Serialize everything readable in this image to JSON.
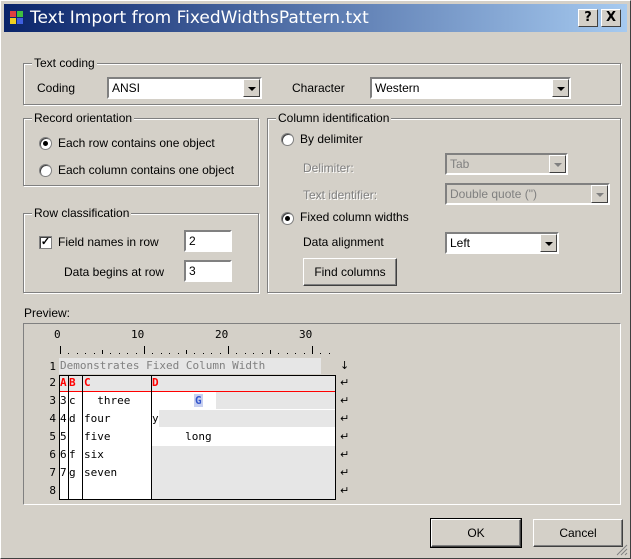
{
  "window": {
    "title": "Text Import from FixedWidthsPattern.txt",
    "help_label": "?",
    "close_label": "X",
    "icon": "table-import-icon"
  },
  "text_coding": {
    "legend": "Text coding",
    "coding_label": "Coding",
    "coding_value": "ANSI",
    "character_label": "Character",
    "character_value": "Western"
  },
  "record_orientation": {
    "legend": "Record orientation",
    "option_rows": "Each row contains one object",
    "option_columns": "Each column contains one object",
    "selected": "rows"
  },
  "row_classification": {
    "legend": "Row classification",
    "field_names_label": "Field names  in row",
    "field_names_checked": true,
    "field_names_row": "2",
    "data_begins_label": "Data begins at row",
    "data_begins_row": "3"
  },
  "column_identification": {
    "legend": "Column identification",
    "by_delimiter_label": "By delimiter",
    "delimiter_label": "Delimiter:",
    "delimiter_value": "Tab",
    "text_identifier_label": "Text identifier:",
    "text_identifier_value": "Double quote (\")",
    "fixed_widths_label": "Fixed column widths",
    "selected": "fixed",
    "data_alignment_label": "Data alignment",
    "data_alignment_value": "Left",
    "find_columns_label": "Find columns"
  },
  "preview": {
    "label": "Preview:",
    "ruler": [
      "0",
      "10",
      "20",
      "30"
    ],
    "row_numbers": [
      "1",
      "2",
      "3",
      "4",
      "5",
      "6",
      "7",
      "8"
    ],
    "row1_text": "Demonstrates Fixed Column Width",
    "row2_cells": [
      "A",
      "B",
      "C",
      "D"
    ],
    "row2_extra": "G",
    "row3_cells": [
      "3",
      "c",
      "  three"
    ],
    "row4_cells": [
      "4",
      "d",
      "four",
      "y"
    ],
    "row5_cells": [
      "5",
      "",
      "five",
      "     long"
    ],
    "row6_cells": [
      "6",
      "f",
      "six"
    ],
    "row7_cells": [
      "7",
      "g",
      "seven"
    ],
    "eol_marker": "↵",
    "row1_marker": "↓"
  },
  "buttons": {
    "ok_label": "OK",
    "cancel_label": "Cancel"
  },
  "colors": {
    "title_start": "#0a246a",
    "title_end": "#a6caf0",
    "field_header": "#ff0000",
    "selection": "#3355cc"
  }
}
